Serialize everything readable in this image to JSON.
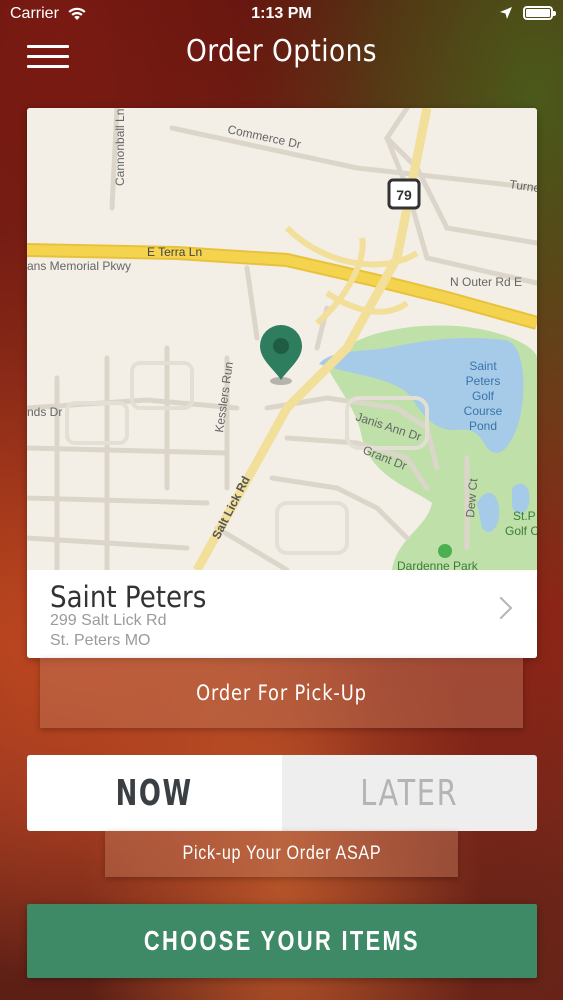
{
  "status_bar": {
    "carrier": "Carrier",
    "time": "1:13 PM"
  },
  "header": {
    "title": "Order Options"
  },
  "map": {
    "labels": {
      "commerce": "Commerce Dr",
      "cannonball": "Cannonball Ln",
      "turner": "Turne",
      "highway": "79",
      "terra": "E Terra Ln",
      "memorial": "ans Memorial Pkwy",
      "outer": "N Outer Rd E",
      "kesslers": "Kesslers Run",
      "janis": "Janis Ann Dr",
      "grant": "Grant Dr",
      "lands": "nds Dr",
      "salt_lick": "Salt Lick Rd",
      "dew": "Dew Ct",
      "pond1": "Saint",
      "pond2": "Peters",
      "pond3": "Golf",
      "pond4": "Course",
      "pond5": "Pond",
      "golf1": "St.P",
      "golf2": "Golf C",
      "park": "Dardenne Park"
    }
  },
  "store": {
    "name": "Saint Peters",
    "address_line1": "299 Salt Lick Rd",
    "address_line2": "St. Peters MO"
  },
  "order_type": {
    "label": "Order For Pick-Up"
  },
  "time_toggle": {
    "now_label": "NOW",
    "later_label": "LATER",
    "selected": "NOW",
    "note": "Pick-up Your Order ASAP"
  },
  "cta": {
    "label": "CHOOSE YOUR ITEMS"
  },
  "colors": {
    "accent_green": "#3f8a66",
    "pin_green": "#2e7d5e",
    "map_road": "#f4d34f",
    "water": "#a6cbe8",
    "park": "#bfe0a8"
  }
}
